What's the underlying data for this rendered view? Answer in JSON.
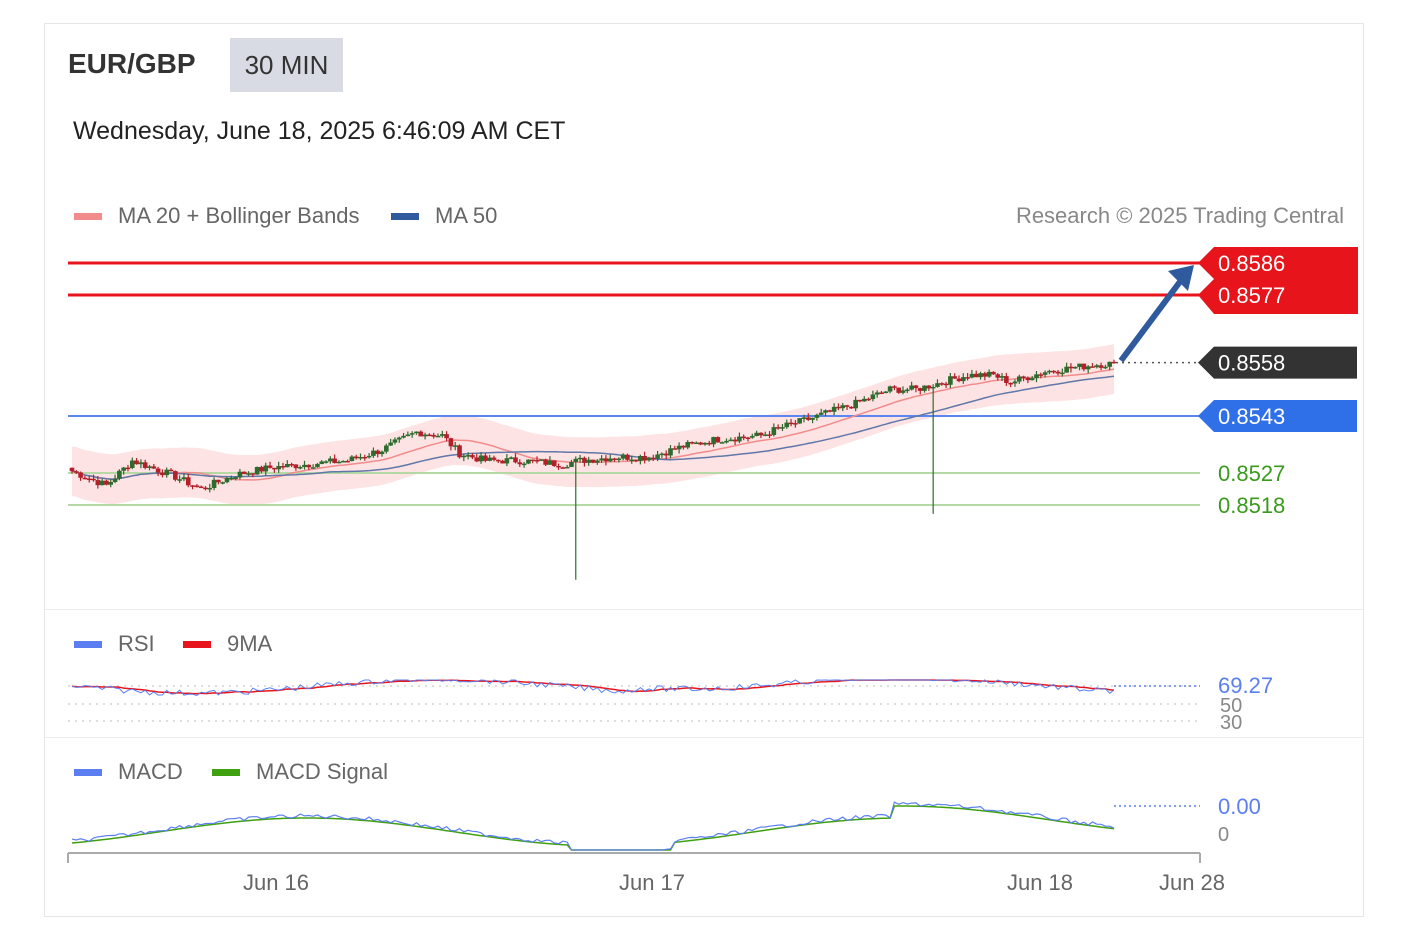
{
  "header": {
    "symbol": "EUR/GBP",
    "timeframe": "30 MIN",
    "datetime": "Wednesday, June 18, 2025 6:46:09 AM CET",
    "credit": "Research © 2025 Trading Central"
  },
  "legends": {
    "price": [
      {
        "label": "MA 20 + Bollinger Bands",
        "color": "#f28b8b"
      },
      {
        "label": "MA 50",
        "color": "#2f5a9e"
      }
    ],
    "rsi": [
      {
        "label": "RSI",
        "color": "#5b7ff0"
      },
      {
        "label": "9MA",
        "color": "#e8141b"
      }
    ],
    "macd": [
      {
        "label": "MACD",
        "color": "#5b7ff0"
      },
      {
        "label": "MACD Signal",
        "color": "#3fa010"
      }
    ]
  },
  "chart_data": [
    {
      "type": "candlestick",
      "panel": "price",
      "series": [
        {
          "name": "MA 20 + Bollinger Bands"
        },
        {
          "name": "MA 50"
        }
      ],
      "ylim": [
        0.84967,
        0.85993
      ],
      "levels": [
        {
          "value": 0.8586,
          "label": "0.8586",
          "kind": "resistance",
          "color": "#e8141b"
        },
        {
          "value": 0.8577,
          "label": "0.8577",
          "kind": "resistance",
          "color": "#e8141b"
        },
        {
          "value": 0.8558,
          "label": "0.8558",
          "kind": "last-price",
          "color": "#333333"
        },
        {
          "value": 0.8543,
          "label": "0.8543",
          "kind": "pivot",
          "color": "#2f6fe8"
        },
        {
          "value": 0.8527,
          "label": "0.8527",
          "kind": "support",
          "color": "#3fa010"
        },
        {
          "value": 0.8518,
          "label": "0.8518",
          "kind": "support",
          "color": "#3fa010"
        }
      ],
      "forecast_arrow": {
        "from": 0.8558,
        "to": 0.8586,
        "color": "#2f5a9e"
      }
    },
    {
      "type": "line",
      "panel": "rsi",
      "series": [
        {
          "name": "RSI"
        },
        {
          "name": "9MA"
        }
      ],
      "last_value": "69.27",
      "ticks": [
        "50",
        "30"
      ]
    },
    {
      "type": "line",
      "panel": "macd",
      "series": [
        {
          "name": "MACD"
        },
        {
          "name": "MACD Signal"
        }
      ],
      "last_value": "0.00",
      "ticks": [
        "0"
      ]
    }
  ],
  "x_axis": {
    "ticks": [
      "Jun 16",
      "Jun 17",
      "Jun 18",
      "Jun 28"
    ]
  }
}
